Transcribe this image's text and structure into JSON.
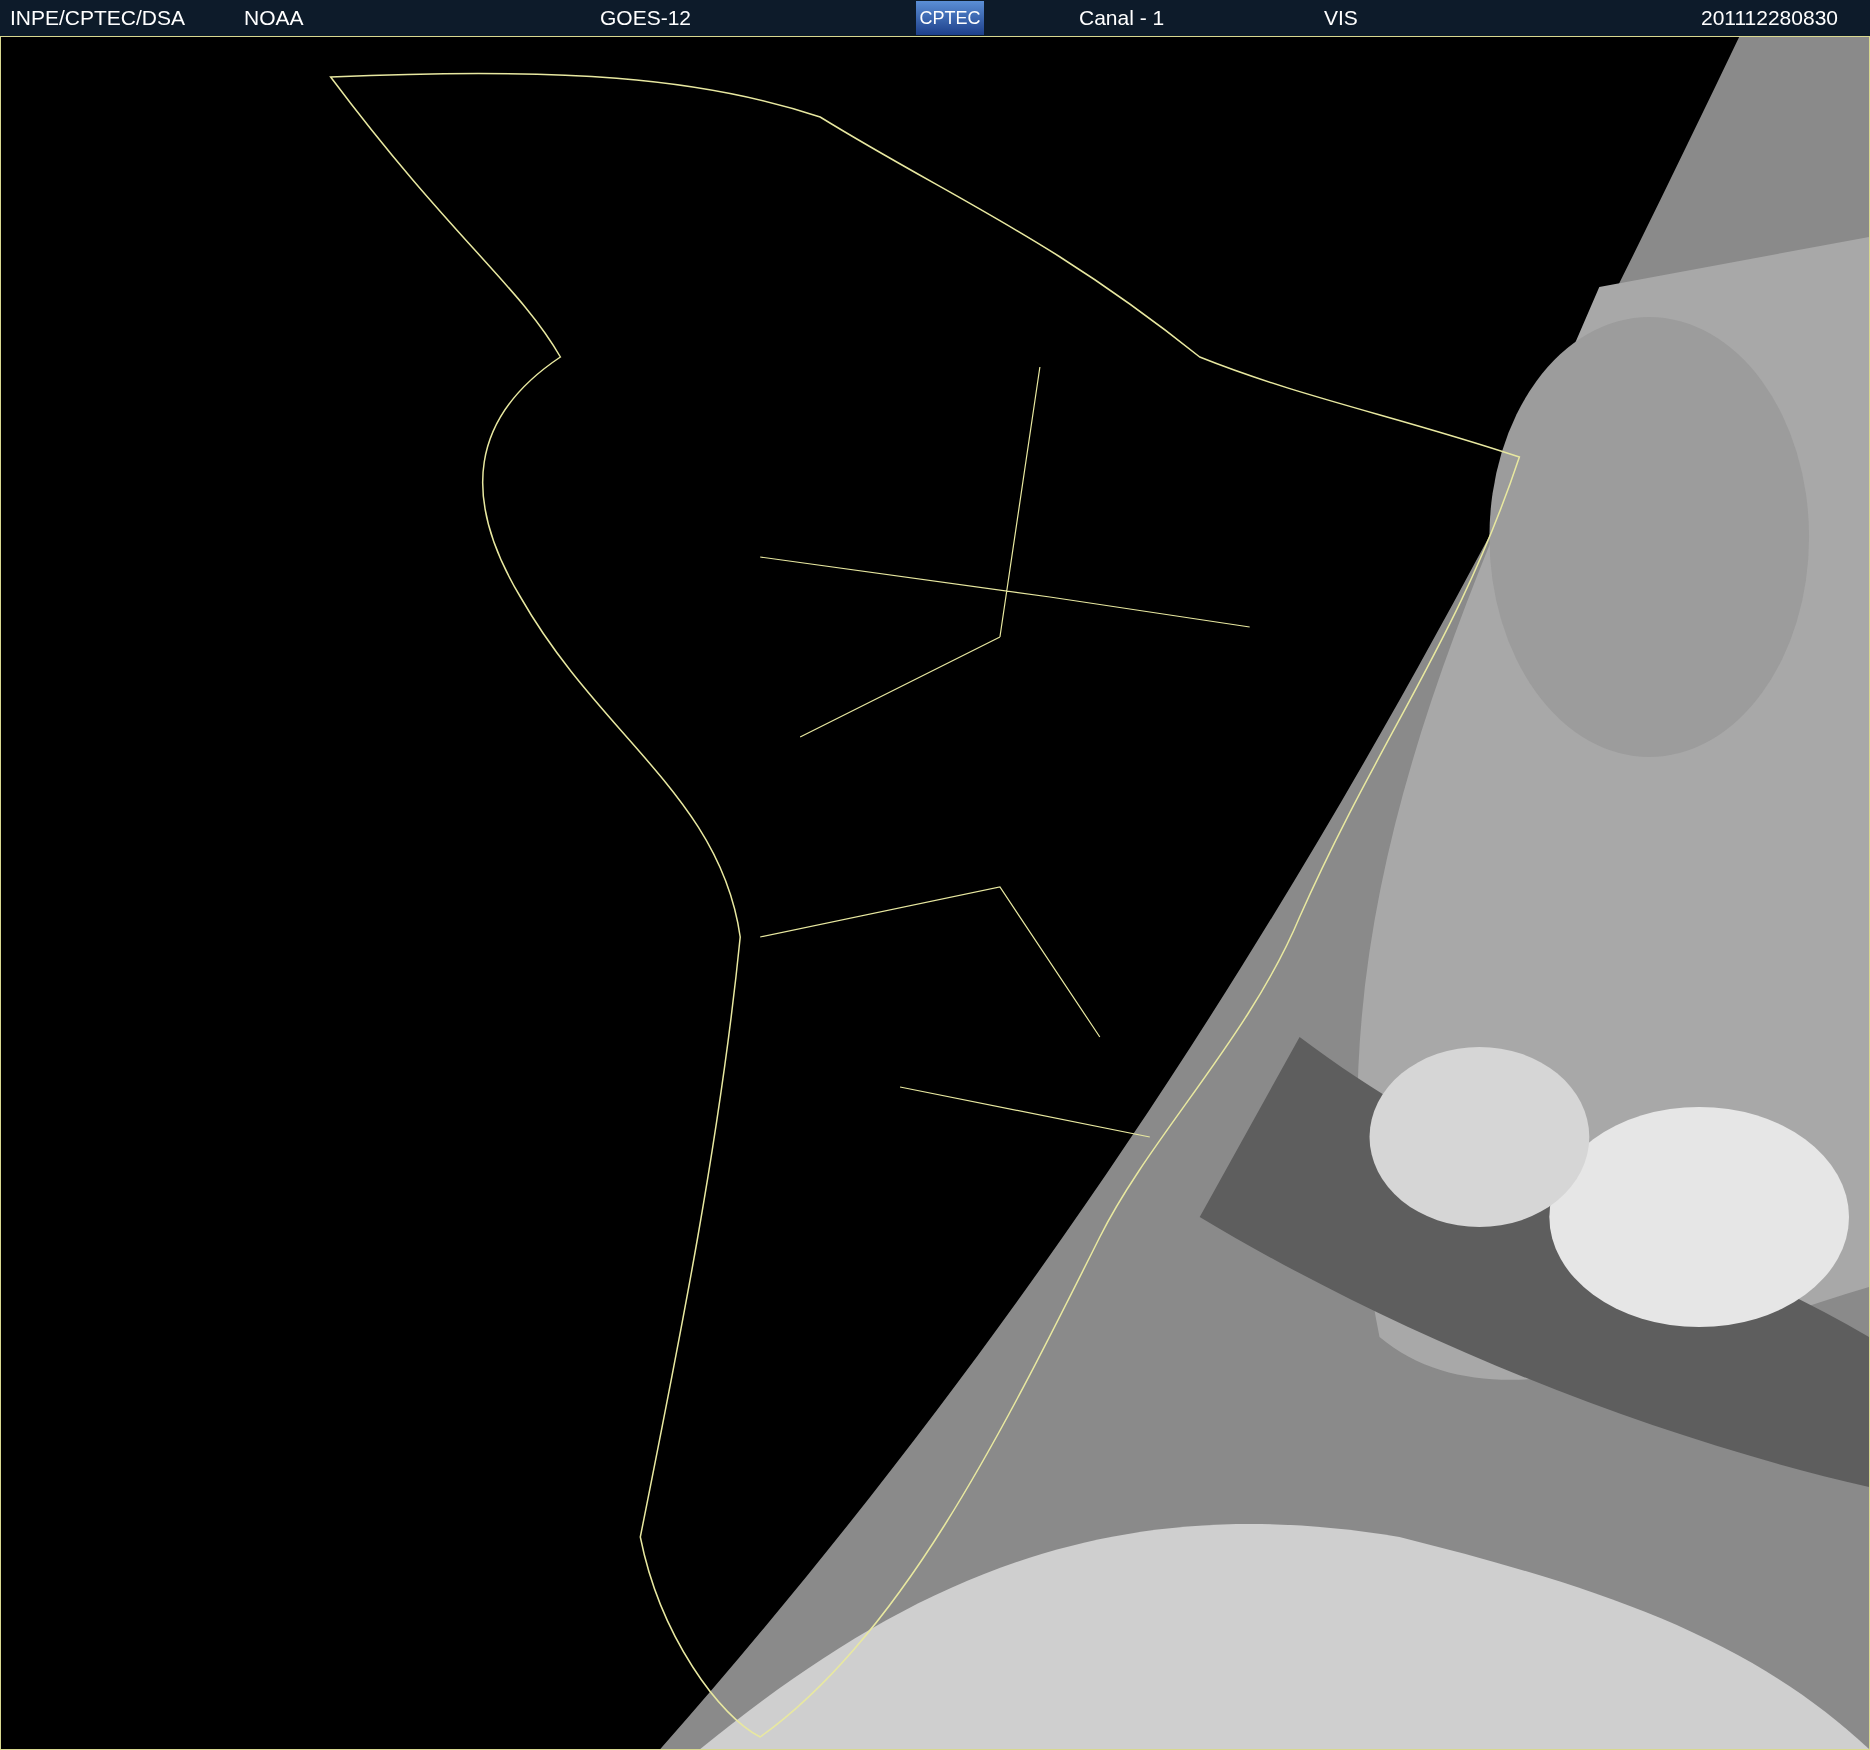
{
  "header": {
    "source": "INPE/CPTEC/DSA",
    "agency": "NOAA",
    "satellite": "GOES-12",
    "logo": "CPTEC",
    "channel": "Canal - 1",
    "band": "VIS",
    "timestamp": "201112280830"
  }
}
